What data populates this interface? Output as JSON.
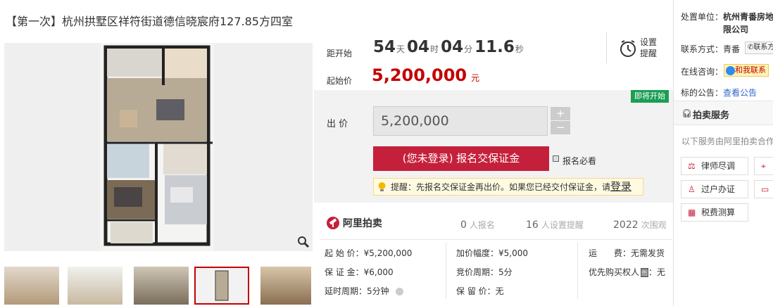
{
  "title": "【第一次】杭州拱墅区祥符街道德信晓宸府127.85方四室",
  "countdown": {
    "label": "距开始",
    "days": "54",
    "days_unit": "天",
    "hours": "04",
    "hours_unit": "时",
    "minutes": "04",
    "minutes_unit": "分",
    "seconds": "11.6",
    "seconds_unit": "秒"
  },
  "remind": {
    "line1": "设置",
    "line2": "提醒"
  },
  "start_price": {
    "label": "起始价",
    "value": "5,200,000",
    "unit": "元"
  },
  "soon_badge": "即将开始",
  "bid": {
    "label": "出 价",
    "value": "5,200,000",
    "plus": "+",
    "minus": "−",
    "signup_button": "(您未登录) 报名交保证金",
    "must_read": "报名必看",
    "tip_text": "提醒：先报名交保证金再出价。如果您已经交付保证金，请",
    "tip_login": "登录"
  },
  "platform": {
    "name": "阿里拍卖"
  },
  "stats": {
    "signups": "0",
    "signups_label": "人报名",
    "reminders": "16",
    "reminders_label": "人设置提醒",
    "views": "2022",
    "views_label": "次围观"
  },
  "info": {
    "col1": [
      "起 始 价：¥5,200,000",
      "保 证 金：¥6,000",
      "延时周期：5分钟"
    ],
    "col2": [
      "加价幅度：¥5,000",
      "竞价周期：5分",
      "保 留 价：无"
    ],
    "col3_shipping": "运　　费：无需发货",
    "col3_priority": "优先购买权人",
    "col3_priority_badge": "图",
    "col3_priority_value": "：无"
  },
  "sidebar": {
    "disposal_label": "处置单位：",
    "disposal_value_1": "杭州青番房地",
    "disposal_value_2": "限公司",
    "contact_label": "联系方式：",
    "contact_name": "青番",
    "contact_btn": "联系方",
    "consult_label": "在线咨询：",
    "consult_btn": "和我联系",
    "notice_label": "标的公告：",
    "notice_link": "查看公告",
    "service_header": "拍卖服务",
    "service_desc": "以下服务由阿里拍卖合作",
    "services": [
      "律师尽调",
      "过户办证",
      "税费测算"
    ]
  },
  "colors": {
    "accent": "#c40000",
    "button": "#c5203b",
    "badge": "#1a9e55",
    "link": "#3366cc"
  }
}
